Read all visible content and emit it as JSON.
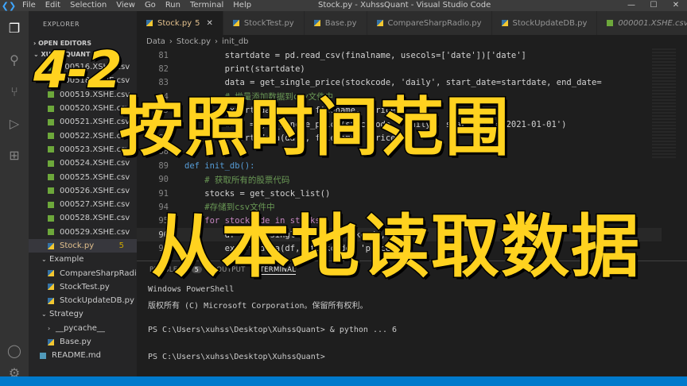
{
  "titlebar": {
    "menu": [
      "File",
      "Edit",
      "Selection",
      "View",
      "Go",
      "Run",
      "Terminal",
      "Help"
    ],
    "title": "Stock.py - XuhssQuant - Visual Studio Code"
  },
  "sidebar": {
    "header": "EXPLORER",
    "open_editors": "OPEN EDITORS",
    "project": "XUHSSQUANT",
    "files": [
      "000516.XSHE.csv",
      "000518.XSHE.csv",
      "000519.XSHE.csv",
      "000520.XSHE.csv",
      "000521.XSHE.csv",
      "000522.XSHE.csv",
      "000523.XSHE.csv",
      "000524.XSHE.csv",
      "000525.XSHE.csv",
      "000526.XSHE.csv",
      "000527.XSHE.csv",
      "000528.XSHE.csv",
      "000529.XSHE.csv"
    ],
    "stock_file": "Stock.py",
    "stock_problems": "5",
    "folder_example": "Example",
    "example_files": [
      "CompareSharpRadio.py",
      "StockTest.py",
      "StockUpdateDB.py"
    ],
    "folder_strategy": "Strategy",
    "folder_pycache": "__pycache__",
    "base_file": "Base.py",
    "readme": "README.md"
  },
  "tabs": [
    {
      "label": "Stock.py",
      "badge": "5",
      "active": true
    },
    {
      "label": "StockTest.py"
    },
    {
      "label": "Base.py"
    },
    {
      "label": "CompareSharpRadio.py"
    },
    {
      "label": "StockUpdateDB.py"
    },
    {
      "label": "000001.XSHE.csv"
    }
  ],
  "breadcrumb": [
    "Data",
    "Stock.py",
    "init_db"
  ],
  "code": [
    {
      "num": "81",
      "text": "        startdate = pd.read_csv(finalname, usecols=['date'])['date']"
    },
    {
      "num": "82",
      "text": "        print(startdate)"
    },
    {
      "num": "83",
      "text": "        data = get_single_price(stockcode, 'daily', start_date=startdate, end_date="
    },
    {
      "num": "84",
      "text": "        # 增量添加数据到csv文件中"
    },
    {
      "num": "85",
      "text": "        export_data(data, filename, 'price')"
    },
    {
      "num": "86",
      "text": "        data = get_single_price(stockcode, 'daily', start_date='2021-01-01')"
    },
    {
      "num": "87",
      "text": "        export_data(data, filename, 'price')"
    },
    {
      "num": "88",
      "text": ""
    },
    {
      "num": "89",
      "text": "def init_db():"
    },
    {
      "num": "90",
      "text": "    # 获取所有的股票代码"
    },
    {
      "num": "91",
      "text": "    stocks = get_stock_list()"
    },
    {
      "num": "94",
      "text": "    #存储到csv文件中"
    },
    {
      "num": "95",
      "text": "    for stockcode in stocks:"
    },
    {
      "num": "96",
      "text": "        df = get_single_price(stockcode,"
    },
    {
      "num": "97",
      "text": "        export_data(df, stockcode, 'price')"
    }
  ],
  "panel": {
    "tabs": [
      "PROBLEMS",
      "OUTPUT",
      "TERMINAL"
    ],
    "problems_count": "5",
    "terminal": [
      "Windows PowerShell",
      "版权所有 (C) Microsoft Corporation。保留所有权利。",
      "",
      "PS C:\\Users\\xuhss\\Desktop\\XuhssQuant> & python ... 6",
      "",
      "PS C:\\Users\\xuhss\\Desktop\\XuhssQuant>"
    ]
  },
  "overlay": {
    "episode": "4-2",
    "line1": "按照时间范围",
    "line2": "从本地读取数据"
  },
  "colors": {
    "overlay_fill": "#ffd21f",
    "overlay_stroke": "#000000",
    "accent": "#007acc"
  }
}
